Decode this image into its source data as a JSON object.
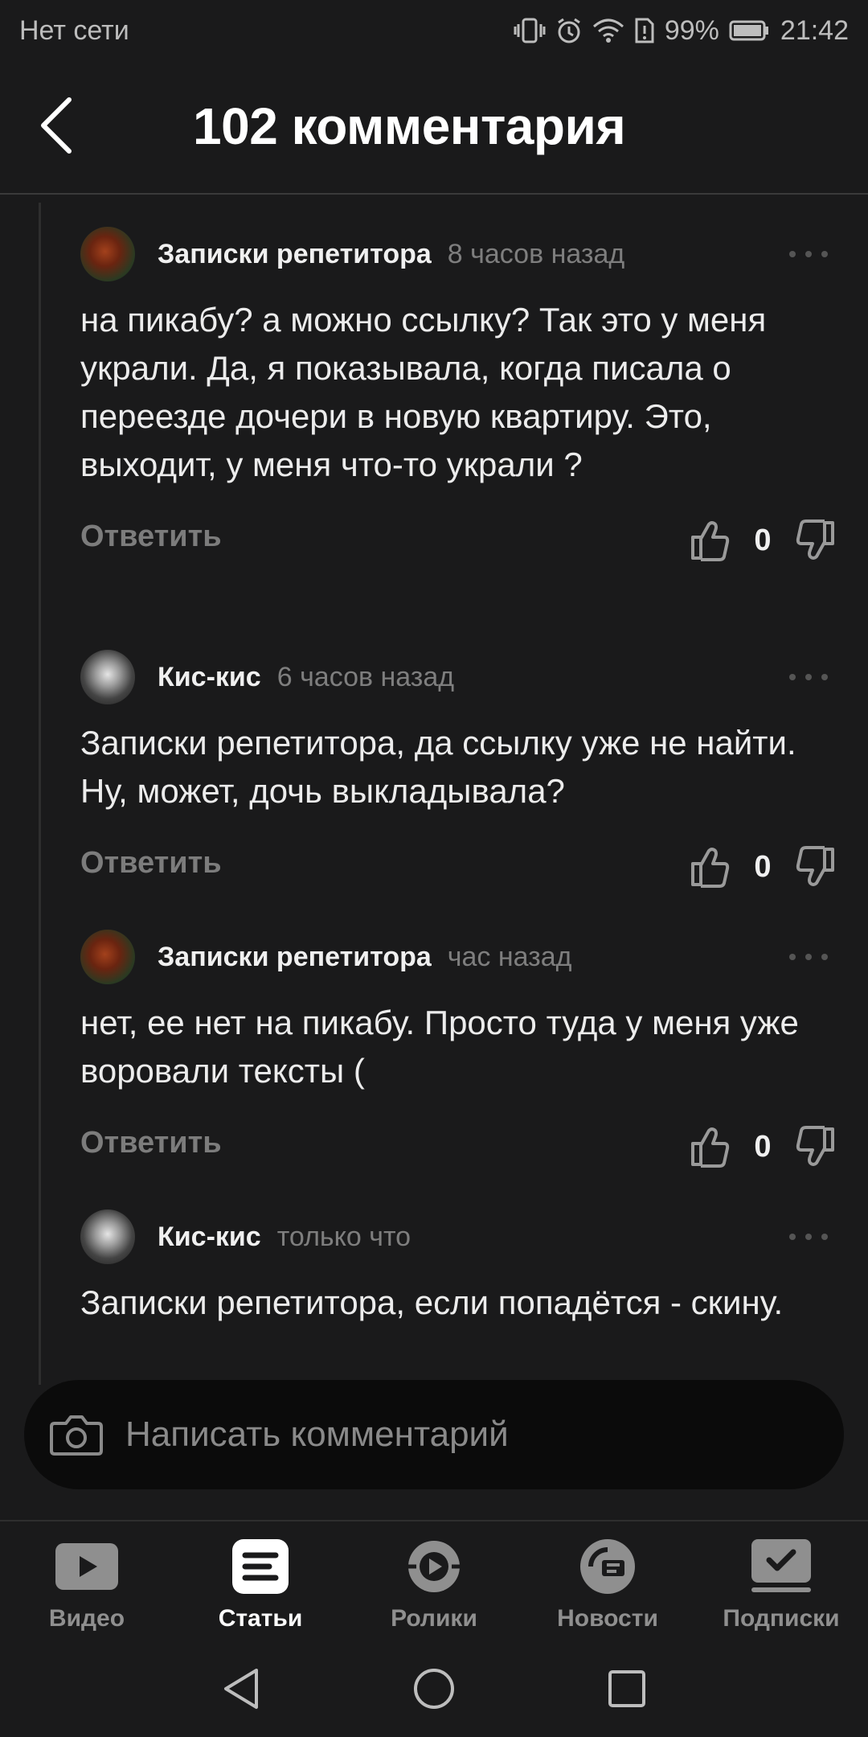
{
  "status_bar": {
    "network": "Нет сети",
    "battery": "99%",
    "time": "21:42"
  },
  "header": {
    "title": "102 комментария"
  },
  "comments": [
    {
      "author": "Записки репетитора",
      "time": "8 часов назад",
      "text": "на пикабу? а можно ссылку? Так это у меня украли. Да, я показывала, когда писала о переезде дочери в новую квартиру. Это, выходит, у меня что-то украли ?",
      "reply": "Ответить",
      "likes": "0"
    },
    {
      "author": "Кис-кис",
      "time": "6 часов назад",
      "text": "Записки репетитора, да ссылку уже не найти. Ну, может, дочь выкладывала?",
      "reply": "Ответить",
      "likes": "0"
    },
    {
      "author": "Записки репетитора",
      "time": "час назад",
      "text": "нет, ее нет на пикабу. Просто туда у меня уже воровали тексты (",
      "reply": "Ответить",
      "likes": "0"
    },
    {
      "author": "Кис-кис",
      "time": "только что",
      "text": "Записки репетитора, если попадётся - скину."
    }
  ],
  "composer": {
    "placeholder": "Написать комментарий"
  },
  "bottom_nav": [
    {
      "label": "Видео",
      "icon": "video-icon"
    },
    {
      "label": "Статьи",
      "icon": "articles-icon"
    },
    {
      "label": "Ролики",
      "icon": "shorts-icon"
    },
    {
      "label": "Новости",
      "icon": "news-icon"
    },
    {
      "label": "Подписки",
      "icon": "subscriptions-icon"
    }
  ]
}
